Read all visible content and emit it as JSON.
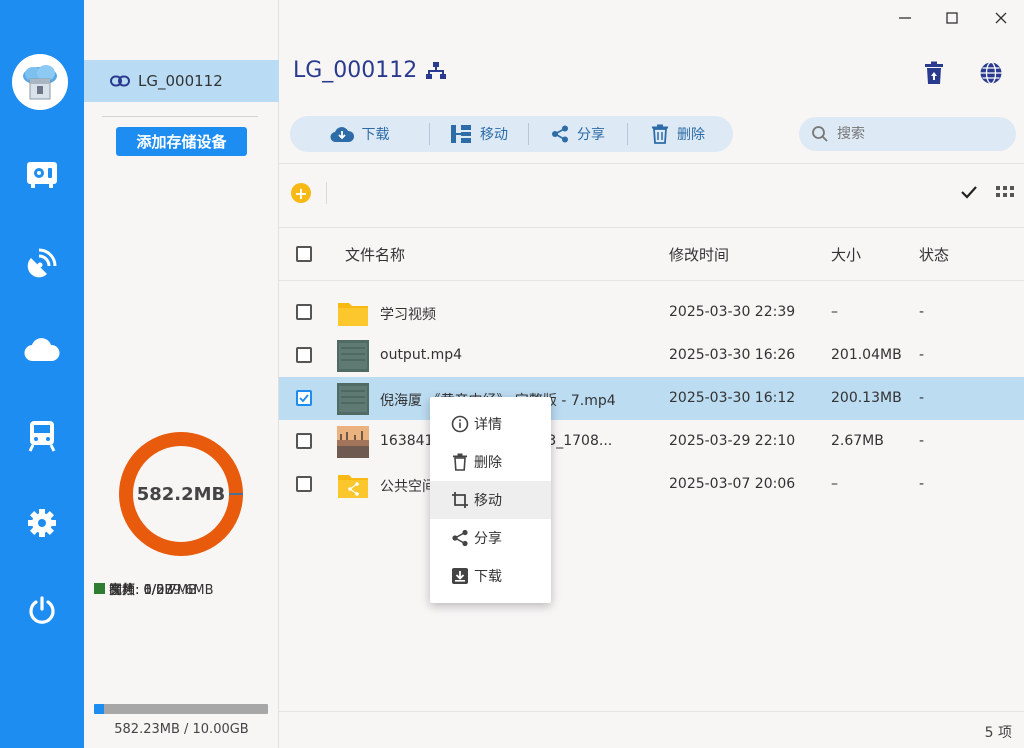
{
  "device": {
    "name": "LG_000112",
    "add_button": "添加存储设备"
  },
  "usage": {
    "total_label": "582.2MB",
    "legend": [
      {
        "label": "视频: 6/579.6MB",
        "color": "#e85a0c"
      },
      {
        "label": "图片: 1/2.7MB",
        "color": "#1976d2"
      },
      {
        "label": "音频: 0/0B",
        "color": "#f8b914"
      },
      {
        "label": "文档: 0/0B",
        "color": "#2e7d32"
      }
    ],
    "used_fraction": 0.057,
    "storage_text": "582.23MB / 10.00GB"
  },
  "main": {
    "title": "LG_000112",
    "toolbar": {
      "download": "下载",
      "move": "移动",
      "share": "分享",
      "delete": "删除"
    },
    "search_placeholder": "搜索",
    "columns": {
      "name": "文件名称",
      "modified": "修改时间",
      "size": "大小",
      "status": "状态"
    },
    "files": [
      {
        "name": "学习视频",
        "modified": "2025-03-30 22:39",
        "size": "–",
        "status": "-",
        "kind": "folder",
        "checked": false
      },
      {
        "name": "output.mp4",
        "modified": "2025-03-30 16:26",
        "size": "201.04MB",
        "status": "-",
        "kind": "video",
        "checked": false
      },
      {
        "name": "倪海厦 《黄帝内经》 完整版 - 7.mp4",
        "modified": "2025-03-30 16:12",
        "size": "200.13MB",
        "status": "-",
        "kind": "video",
        "checked": true
      },
      {
        "name": "1638413211113_211113_1708...",
        "modified": "2025-03-29 22:10",
        "size": "2.67MB",
        "status": "-",
        "kind": "image",
        "checked": false
      },
      {
        "name": "公共空间",
        "modified": "2025-03-07 20:06",
        "size": "–",
        "status": "-",
        "kind": "shared-folder",
        "checked": false
      }
    ],
    "item_count": "5 项"
  },
  "context_menu": {
    "items": [
      {
        "label": "详情",
        "icon": "info-icon"
      },
      {
        "label": "删除",
        "icon": "trash-icon"
      },
      {
        "label": "移动",
        "icon": "crop-move-icon"
      },
      {
        "label": "分享",
        "icon": "share-icon"
      },
      {
        "label": "下载",
        "icon": "download-box-icon"
      }
    ]
  },
  "colors": {
    "accent": "#1e8df2",
    "selected_row": "#bcdcf2",
    "title": "#2a3b8f"
  }
}
